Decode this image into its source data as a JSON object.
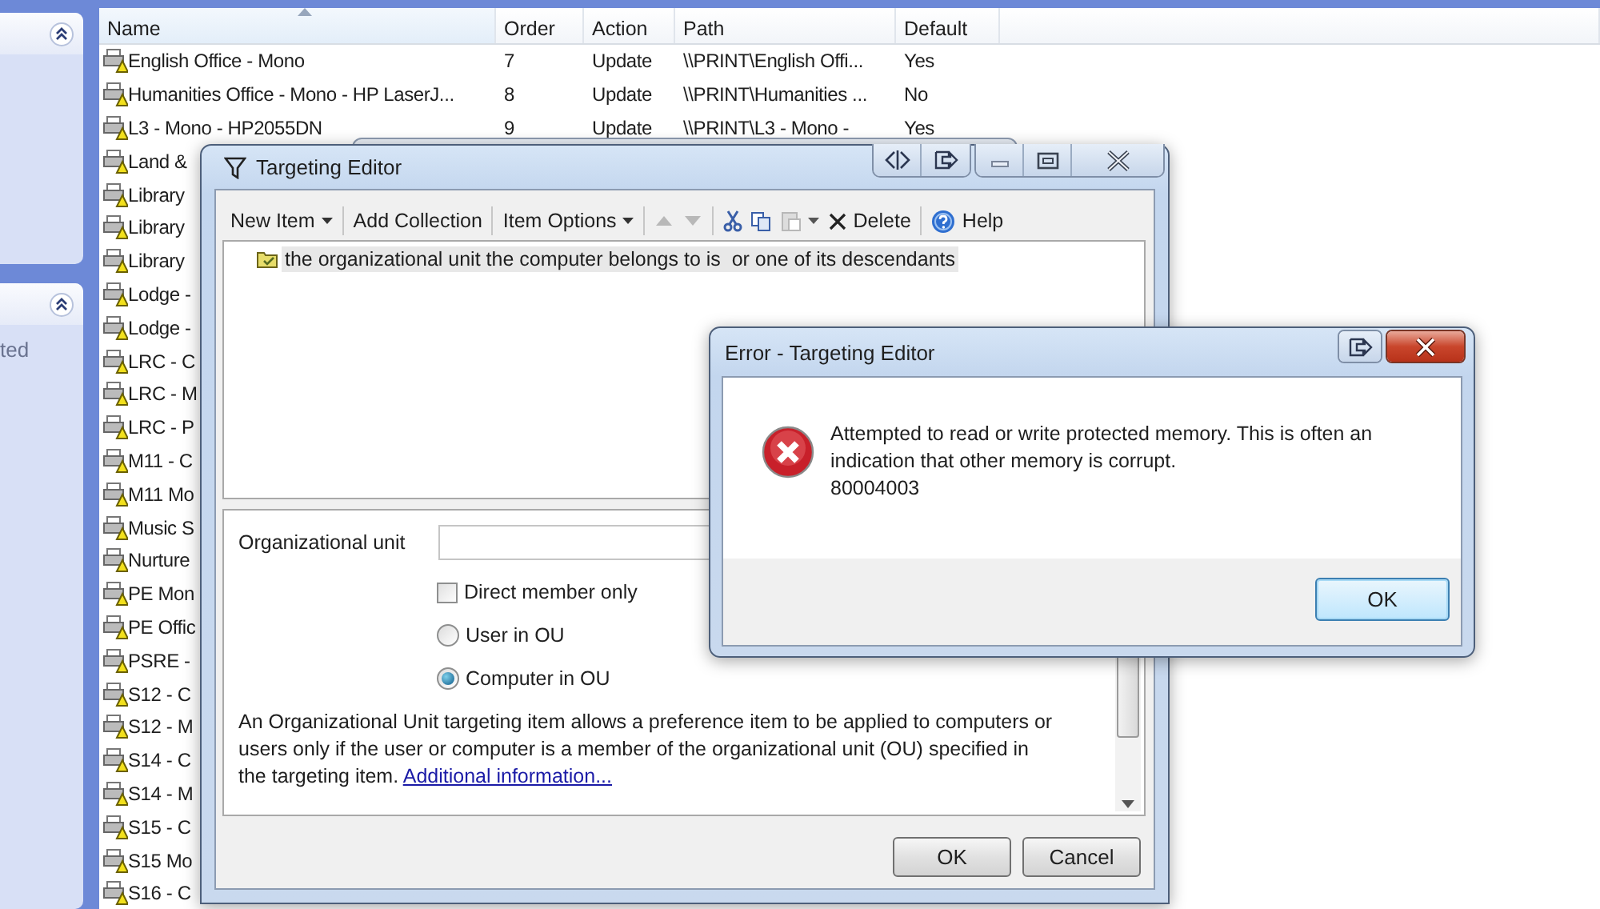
{
  "sidebar": {
    "panels": [
      {
        "expanded": true
      },
      {
        "expanded": true,
        "text": "ted"
      }
    ]
  },
  "table": {
    "columns": [
      {
        "label": "Name",
        "sorted": true
      },
      {
        "label": "Order",
        "sorted": false
      },
      {
        "label": "Action",
        "sorted": false
      },
      {
        "label": "Path",
        "sorted": false
      },
      {
        "label": "Default",
        "sorted": false
      }
    ],
    "rows": [
      {
        "cells": [
          "English Office - Mono",
          "7",
          "Update",
          "\\\\PRINT\\English Offi...",
          "Yes"
        ]
      },
      {
        "cells": [
          "Humanities Office - Mono - HP LaserJ...",
          "8",
          "Update",
          "\\\\PRINT\\Humanities ...",
          "No"
        ]
      },
      {
        "cells": [
          "L3 - Mono - HP2055DN",
          "9",
          "Update",
          "\\\\PRINT\\L3 - Mono -",
          "Yes"
        ]
      },
      {
        "cells": [
          "Land &"
        ]
      },
      {
        "cells": [
          "Library"
        ]
      },
      {
        "cells": [
          "Library"
        ]
      },
      {
        "cells": [
          "Library"
        ]
      },
      {
        "cells": [
          "Lodge -"
        ]
      },
      {
        "cells": [
          "Lodge -"
        ]
      },
      {
        "cells": [
          "LRC - C"
        ]
      },
      {
        "cells": [
          "LRC - M"
        ]
      },
      {
        "cells": [
          "LRC - P"
        ]
      },
      {
        "cells": [
          "M11 - C"
        ]
      },
      {
        "cells": [
          "M11 Mo"
        ]
      },
      {
        "cells": [
          "Music S"
        ]
      },
      {
        "cells": [
          "Nurture"
        ]
      },
      {
        "cells": [
          "PE Mon"
        ]
      },
      {
        "cells": [
          "PE Offic"
        ]
      },
      {
        "cells": [
          "PSRE -"
        ]
      },
      {
        "cells": [
          "S12 - C"
        ]
      },
      {
        "cells": [
          "S12 - M"
        ]
      },
      {
        "cells": [
          "S14 - C"
        ]
      },
      {
        "cells": [
          "S14 - M"
        ]
      },
      {
        "cells": [
          "S15 - C"
        ]
      },
      {
        "cells": [
          "S15 Mo"
        ]
      },
      {
        "cells": [
          "S16 - C"
        ]
      }
    ]
  },
  "editor": {
    "title": "Targeting Editor",
    "toolbar": [
      [
        {
          "kind": "dropdown",
          "label": "New Item",
          "disabled": false
        }
      ],
      [
        {
          "kind": "button",
          "label": "Add Collection",
          "disabled": false
        }
      ],
      [
        {
          "kind": "dropdown",
          "label": "Item Options",
          "disabled": false
        }
      ],
      [
        {
          "kind": "up",
          "disabled": true
        },
        {
          "kind": "down",
          "disabled": true
        }
      ],
      [
        {
          "kind": "cut",
          "disabled": false
        },
        {
          "kind": "copy",
          "disabled": false
        },
        {
          "kind": "paste",
          "disabled": true
        },
        {
          "kind": "delete",
          "label": "Delete",
          "disabled": false
        }
      ],
      [
        {
          "kind": "help",
          "label": "Help",
          "disabled": false
        }
      ]
    ],
    "tree": [
      {
        "label": "the organizational unit the computer belongs to is  or one of its descendants",
        "selected": true
      }
    ],
    "field_label": "Organizational unit",
    "options": [
      {
        "kind": "checkbox",
        "label": "Direct member only",
        "checked": false
      },
      {
        "kind": "radio",
        "label": "User in OU",
        "selected": false
      },
      {
        "kind": "radio",
        "label": "Computer in OU",
        "selected": true
      }
    ],
    "description": "An Organizational Unit targeting item allows a preference item to be applied to computers or users only if the user or computer is a member of the organizational unit (OU) specified in the targeting item.",
    "link": "Additional information...",
    "buttons": [
      "OK",
      "Cancel"
    ]
  },
  "error": {
    "title": "Error - Targeting Editor",
    "message": "Attempted to read or write protected memory. This is often an indication that other memory is corrupt.",
    "code": "80004003",
    "button": "OK"
  }
}
